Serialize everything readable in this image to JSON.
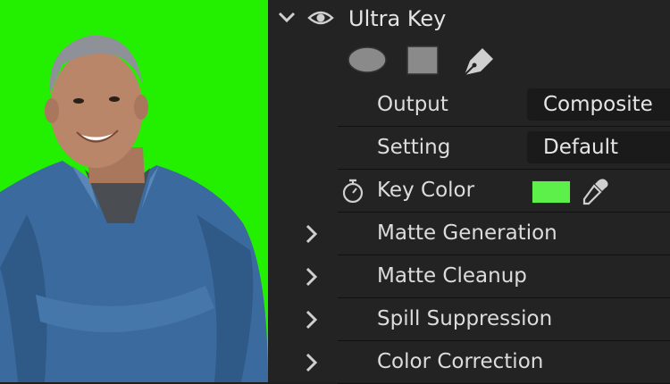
{
  "effect": {
    "title": "Ultra Key",
    "expanded_icon": "chevron-down-icon",
    "visibility_icon": "eye-icon"
  },
  "mask_tools": [
    "ellipse-mask-icon",
    "rectangle-mask-icon",
    "pen-mask-icon"
  ],
  "params": {
    "output": {
      "label": "Output",
      "value": "Composite"
    },
    "setting": {
      "label": "Setting",
      "value": "Default"
    },
    "key_color": {
      "label": "Key Color",
      "color": "#5ef04a"
    }
  },
  "groups": [
    {
      "label": "Matte Generation"
    },
    {
      "label": "Matte Cleanup"
    },
    {
      "label": "Spill Suppression"
    },
    {
      "label": "Color Correction"
    }
  ],
  "colors": {
    "green_screen": "#22f000",
    "panel_bg": "#232323",
    "text": "#dcdcdc"
  }
}
